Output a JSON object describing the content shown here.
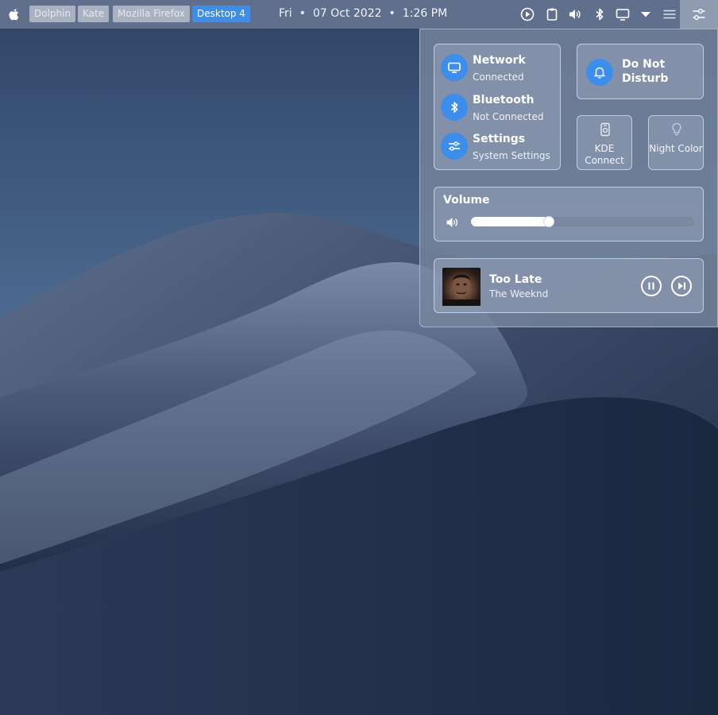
{
  "taskbar": {
    "apps": [
      {
        "label": "Dolphin"
      },
      {
        "label": "Kate"
      },
      {
        "label": "Mozilla Firefox"
      },
      {
        "label": "Desktop 4"
      }
    ]
  },
  "clock": {
    "day": "Fri",
    "date": "07 Oct 2022",
    "time": "1:26 PM",
    "separator": "•"
  },
  "tray": {
    "icons": [
      "media-player-icon",
      "clipboard-icon",
      "volume-icon",
      "bluetooth-icon",
      "display-icon",
      "expand-arrow-icon",
      "menu-icon",
      "control-center-icon"
    ]
  },
  "control_center": {
    "network": {
      "title": "Network",
      "status": "Connected"
    },
    "bluetooth": {
      "title": "Bluetooth",
      "status": "Not Connected"
    },
    "settings": {
      "title": "Settings",
      "status": "System Settings"
    },
    "dnd": {
      "title": "Do Not Disturb"
    },
    "kde_connect": {
      "label": "KDE Connect"
    },
    "night_color": {
      "label": "Night Color"
    },
    "volume": {
      "title": "Volume",
      "level": 0.35
    },
    "media": {
      "title": "Too Late",
      "artist": "The Weeknd"
    },
    "accent": "#3d8eea"
  }
}
